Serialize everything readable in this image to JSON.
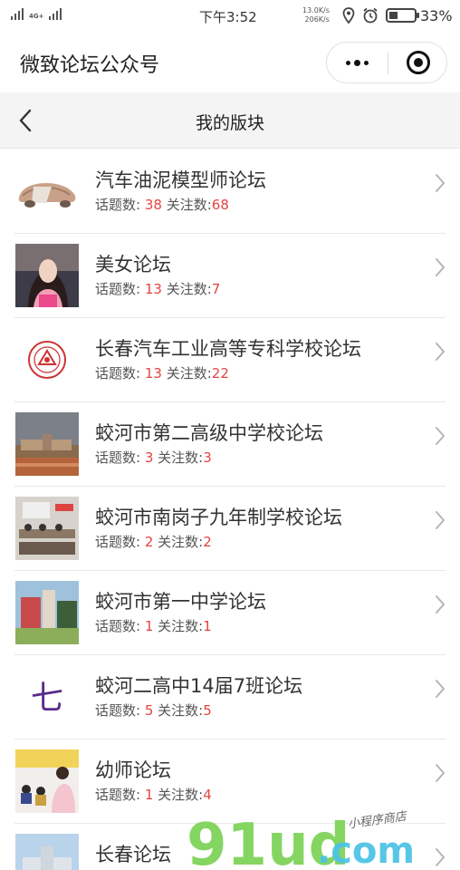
{
  "status_bar": {
    "network": "4G+",
    "time": "下午3:52",
    "speed_up": "13.0K/s",
    "speed_down": "206K/s",
    "battery_percent": "33%",
    "battery_level": 0.33
  },
  "app": {
    "title": "微致论坛公众号"
  },
  "header": {
    "title": "我的版块"
  },
  "forums": [
    {
      "name": "汽车油泥模型师论坛",
      "topics_label": "话题数:",
      "topics": "38",
      "follows_label": "关注数:",
      "follows": "68",
      "thumb": "car-clay-model"
    },
    {
      "name": "美女论坛",
      "topics_label": "话题数:",
      "topics": "13",
      "follows_label": "关注数:",
      "follows": "7",
      "thumb": "woman-portrait"
    },
    {
      "name": "长春汽车工业高等专科学校论坛",
      "topics_label": "话题数:",
      "topics": "13",
      "follows_label": "关注数:",
      "follows": "22",
      "thumb": "school-seal"
    },
    {
      "name": "蛟河市第二高级中学校论坛",
      "topics_label": "话题数:",
      "topics": "3",
      "follows_label": "关注数:",
      "follows": "3",
      "thumb": "school-building"
    },
    {
      "name": "蛟河市南岗子九年制学校论坛",
      "topics_label": "话题数:",
      "topics": "2",
      "follows_label": "关注数:",
      "follows": "2",
      "thumb": "classroom"
    },
    {
      "name": "蛟河市第一中学论坛",
      "topics_label": "话题数:",
      "topics": "1",
      "follows_label": "关注数:",
      "follows": "1",
      "thumb": "school-campus"
    },
    {
      "name": "蛟河二高中14届7班论坛",
      "topics_label": "话题数:",
      "topics": "5",
      "follows_label": "关注数:",
      "follows": "5",
      "thumb": "character-seven",
      "thumb_char": "七"
    },
    {
      "name": "幼师论坛",
      "topics_label": "话题数:",
      "topics": "1",
      "follows_label": "关注数:",
      "follows": "4",
      "thumb": "kindergarten"
    },
    {
      "name": "长春论坛",
      "topics_label": "",
      "topics": "",
      "follows_label": "",
      "follows": "",
      "thumb": "city-building"
    }
  ],
  "watermark": {
    "main": "91ud",
    "suffix": ".com",
    "tagline": "小程序商店"
  },
  "colors": {
    "accent_number": "#e64340",
    "header_bg": "#f4f4f4",
    "watermark_green": "#7fd35a"
  }
}
